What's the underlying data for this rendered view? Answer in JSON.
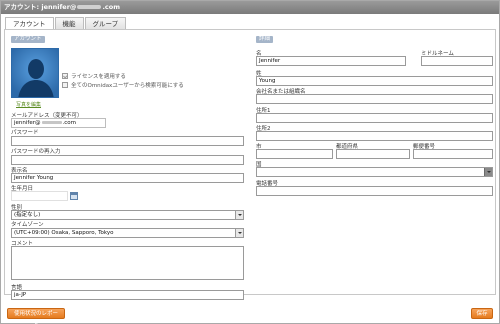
{
  "window": {
    "title_prefix": "アカウント: jennifer@",
    "title_suffix": ".com"
  },
  "tabs": [
    {
      "label": "アカウント",
      "active": true
    },
    {
      "label": "機能",
      "active": false
    },
    {
      "label": "グループ",
      "active": false
    }
  ],
  "account": {
    "section_label": "アカウント",
    "photo_link": "写真を編集",
    "apply_license_label": "ライセンスを適用する",
    "apply_license_checked": true,
    "hide_from_users_label": "全てのOmnidaxユーザーから検索可能にする",
    "hide_from_users_checked": false,
    "email_label": "メールアドレス（変更不可）",
    "email_prefix": "jennifer@",
    "email_suffix": ".com",
    "password_label": "パスワード",
    "password_value": "",
    "password_confirm_label": "パスワードの再入力",
    "password_confirm_value": "",
    "display_name_label": "表示名",
    "display_name_value": "Jennifer Young",
    "birthday_label": "生年月日",
    "birthday_value": "",
    "gender_label": "性別",
    "gender_value": "(指定なし)",
    "timezone_label": "タイムゾーン",
    "timezone_value": "(UTC+09:00) Osaka, Sapporo, Tokyo",
    "comment_label": "コメント",
    "language_label": "言語",
    "language_value": "ja-JP"
  },
  "info": {
    "section_label": "詳細",
    "first_name_label": "名",
    "first_name_value": "Jennifer",
    "middle_name_label": "ミドルネーム",
    "middle_name_value": "",
    "last_name_label": "姓",
    "last_name_value": "Young",
    "company_label": "会社名または組織名",
    "company_value": "",
    "address1_label": "住所1",
    "address1_value": "",
    "address2_label": "住所2",
    "address2_value": "",
    "city_label": "市",
    "city_value": "",
    "prefecture_label": "都道府県",
    "prefecture_value": "",
    "postal_label": "郵便番号",
    "postal_value": "",
    "country_label": "国",
    "country_value": "",
    "phone_label": "電話番号",
    "phone_value": ""
  },
  "buttons": {
    "usage_report": "使用状況のレポート",
    "save": "保存"
  },
  "colors": {
    "accent_orange": "#e57b1e",
    "section_header": "#a5b5c9",
    "photo_bg": "#3a7cc2"
  }
}
